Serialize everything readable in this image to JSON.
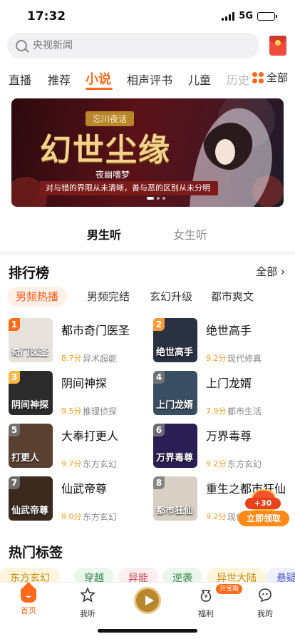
{
  "status": {
    "time": "17:32",
    "network": "5G",
    "battery_level": 0.6
  },
  "search": {
    "placeholder": "央视新闻"
  },
  "tabs": [
    {
      "label": "直播"
    },
    {
      "label": "推荐"
    },
    {
      "label": "小说",
      "active": true
    },
    {
      "label": "相声评书"
    },
    {
      "label": "儿童"
    },
    {
      "label": "历史"
    }
  ],
  "all_categories_label": "全部",
  "banner": {
    "tag": "忘川夜话",
    "title": "幻世尘缘",
    "author": "夜幽嗜梦",
    "slogan": "对与错的界限从未清晰，善与恶的区别从未分明"
  },
  "gender_tabs": [
    {
      "label": "男生听",
      "active": true
    },
    {
      "label": "女生听",
      "active": false
    }
  ],
  "ranking": {
    "title": "排行榜",
    "more_label": "全部",
    "chips": [
      {
        "label": "男频热播",
        "active": true
      },
      {
        "label": "男频完结"
      },
      {
        "label": "玄幻升级"
      },
      {
        "label": "都市爽文"
      }
    ],
    "items": [
      {
        "rank": "1",
        "name": "都市奇门医圣",
        "score": "8.7分",
        "category": "异术超能",
        "cover_text": "奇门医圣",
        "cover_color": "#e8e2dc"
      },
      {
        "rank": "2",
        "name": "绝世高手",
        "score": "9.2分",
        "category": "现代修真",
        "cover_text": "绝世高手",
        "cover_color": "#2a3140"
      },
      {
        "rank": "3",
        "name": "阴间神探",
        "score": "9.5分",
        "category": "推理侦探",
        "cover_text": "阴间神探",
        "cover_color": "#2b2b2b"
      },
      {
        "rank": "4",
        "name": "上门龙婿",
        "score": "7.9分",
        "category": "都市生活",
        "cover_text": "上门龙婿",
        "cover_color": "#3a4e63"
      },
      {
        "rank": "5",
        "name": "大奉打更人",
        "score": "9.7分",
        "category": "东方玄幻",
        "cover_text": "打更人",
        "cover_color": "#5a4030"
      },
      {
        "rank": "6",
        "name": "万界毒尊",
        "score": "9.2分",
        "category": "东方玄幻",
        "cover_text": "万界毒尊",
        "cover_color": "#2a1f55"
      },
      {
        "rank": "7",
        "name": "仙武帝尊",
        "score": "9.0分",
        "category": "东方玄幻",
        "cover_text": "仙武帝尊",
        "cover_color": "#3b2a1e"
      },
      {
        "rank": "8",
        "name": "重生之都市狂仙",
        "score": "9.2分",
        "category": "现代修真",
        "cover_text": "都市狂仙",
        "cover_color": "#d8d0c4"
      }
    ]
  },
  "reward": {
    "plus": "+30",
    "button": "立即领取"
  },
  "hot_tags": {
    "title": "热门标签",
    "tags": [
      {
        "label": "东方玄幻",
        "bg": "#fff5dc",
        "color": "#c98a10"
      },
      {
        "label": "穿越",
        "bg": "#eaf5ec",
        "color": "#3a8a4a"
      },
      {
        "label": "异能",
        "bg": "#fdeef0",
        "color": "#c84a5a"
      },
      {
        "label": "逆袭",
        "bg": "#eaf5ec",
        "color": "#3a8a4a"
      },
      {
        "label": "异世大陆",
        "bg": "#fff5dc",
        "color": "#c98a10"
      },
      {
        "label": "悬疑",
        "bg": "#eef0fa",
        "color": "#4a5ac8"
      }
    ]
  },
  "nav": [
    {
      "label": "首页",
      "active": true
    },
    {
      "label": "我听"
    },
    {
      "label": "福利",
      "badge": "开宝箱"
    },
    {
      "label": "我的"
    }
  ],
  "colors": {
    "accent": "#ff6a1a"
  }
}
